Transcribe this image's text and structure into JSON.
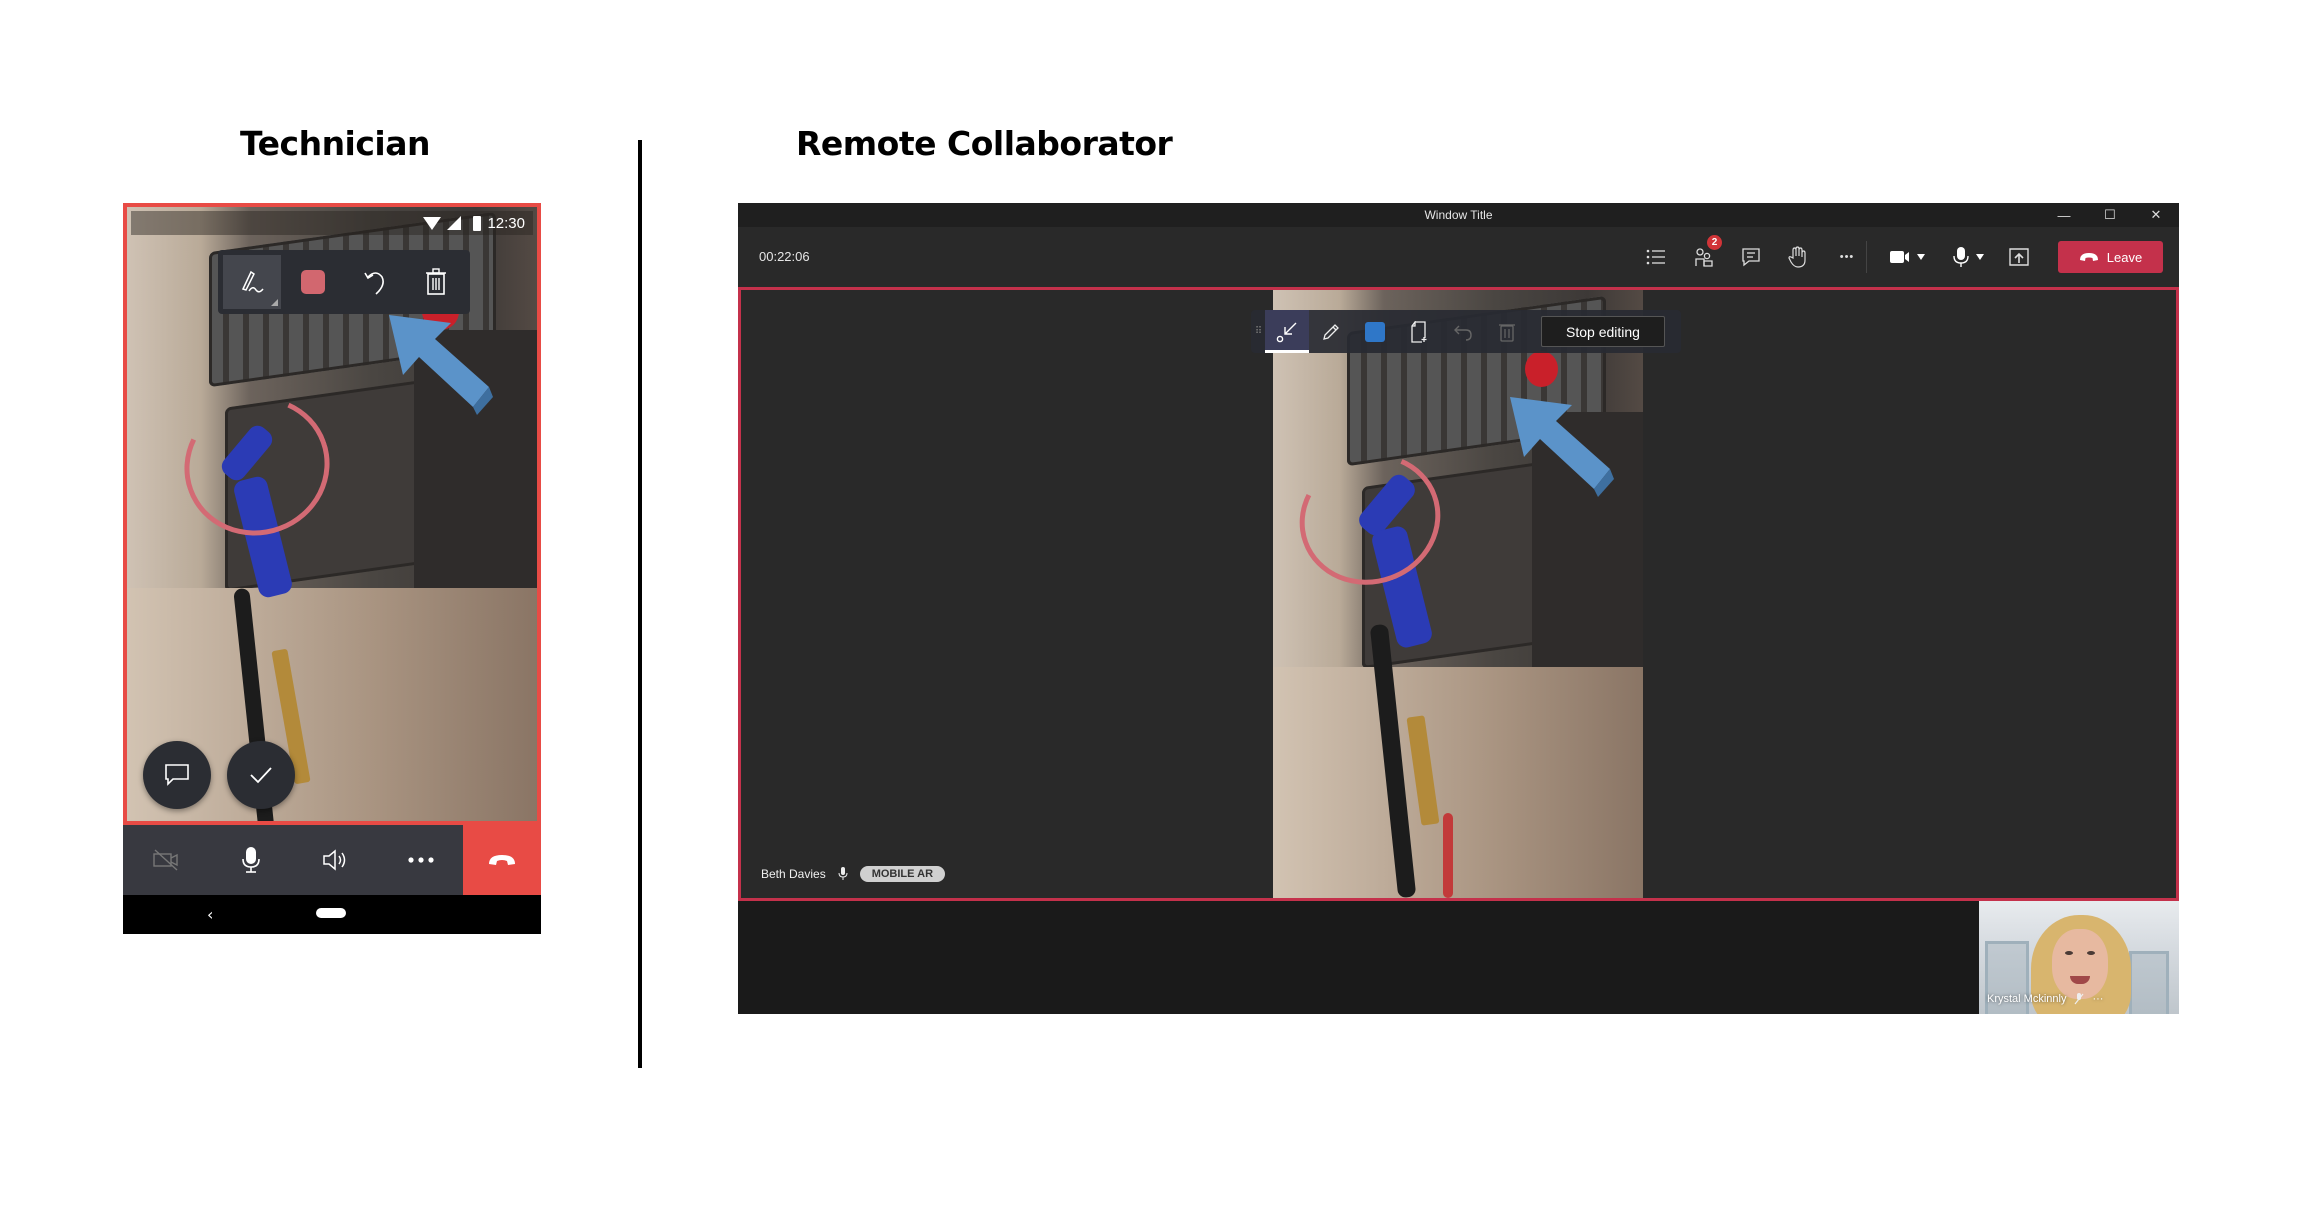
{
  "headings": {
    "technician": "Technician",
    "remote": "Remote Collaborator"
  },
  "phone": {
    "status_bar": {
      "time": "12:30",
      "icons": [
        "wifi-icon",
        "signal-icon",
        "battery-icon"
      ]
    },
    "annotation_toolbar": {
      "tools": [
        {
          "name": "ink-pen",
          "icon": "pen-signature-icon",
          "active": true
        },
        {
          "name": "color",
          "icon": "color-swatch",
          "color": "#d2676f"
        },
        {
          "name": "undo",
          "icon": "undo-icon"
        },
        {
          "name": "delete",
          "icon": "trash-icon"
        }
      ]
    },
    "fab_buttons": [
      {
        "name": "chat",
        "icon": "chat-bubble-icon"
      },
      {
        "name": "done",
        "icon": "checkmark-icon"
      }
    ],
    "call_controls": [
      {
        "name": "camera-off",
        "icon": "video-off-icon",
        "disabled": true
      },
      {
        "name": "microphone",
        "icon": "microphone-icon"
      },
      {
        "name": "speaker",
        "icon": "speaker-icon"
      },
      {
        "name": "more",
        "icon": "more-dots-icon"
      },
      {
        "name": "hang-up",
        "icon": "hang-up-icon",
        "color": "#e84b45"
      }
    ],
    "nav": {
      "back": "‹"
    },
    "annotations": {
      "circle_color": "#d36a74",
      "arrow_color": "#5b93c9"
    }
  },
  "teams": {
    "window_title": "Window Title",
    "window_controls": {
      "minimize": "—",
      "maximize": "☐",
      "close": "✕"
    },
    "call_timer": "00:22:06",
    "toolbar": {
      "list_icon": "list-icon",
      "participants_badge": "2",
      "chat_icon": "chat-icon",
      "raise_hand_icon": "hand-icon",
      "more": "•••",
      "camera_icon": "camera-icon",
      "mic_icon": "microphone-icon",
      "share_icon": "share-screen-icon",
      "leave_label": "Leave",
      "leave_color": "#c4314b"
    },
    "ink_toolbar": {
      "tools": [
        {
          "name": "arrow",
          "icon": "arrow-pointer-icon",
          "active": true
        },
        {
          "name": "pen",
          "icon": "pencil-icon"
        },
        {
          "name": "color",
          "icon": "color-swatch",
          "color": "#2f77c8"
        },
        {
          "name": "new-page",
          "icon": "page-add-icon"
        },
        {
          "name": "undo",
          "icon": "undo-icon",
          "disabled": true
        },
        {
          "name": "delete",
          "icon": "trash-icon",
          "disabled": true
        }
      ],
      "stop_editing_label": "Stop editing"
    },
    "stage": {
      "participant_name": "Beth Davies",
      "tag": "MOBILE AR",
      "border_color": "#c4314b"
    },
    "self_view": {
      "name": "Krystal Mckinnly",
      "more": "···"
    }
  }
}
